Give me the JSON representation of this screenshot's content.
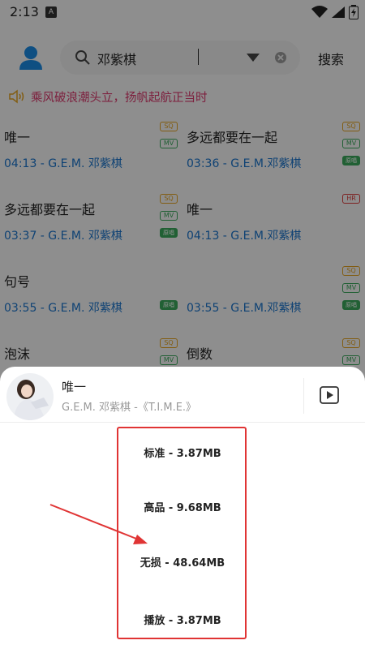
{
  "status": {
    "time": "2:13"
  },
  "search": {
    "query": "邓紫棋",
    "button": "搜索"
  },
  "notice": {
    "text": "乘风破浪潮头立，扬帆起航正当时"
  },
  "songs": [
    {
      "title": "唯一",
      "meta": "04:13 - G.E.M. 邓紫棋",
      "badges": [
        "SQ",
        "MV"
      ]
    },
    {
      "title": "多远都要在一起",
      "meta": "03:36 - G.E.M.邓紫棋",
      "badges": [
        "SQ",
        "MV",
        "原唱"
      ]
    },
    {
      "title": "多远都要在一起",
      "meta": "03:37 - G.E.M. 邓紫棋",
      "badges": [
        "SQ",
        "MV",
        "原唱"
      ]
    },
    {
      "title": "唯一",
      "meta": "04:13 - G.E.M.邓紫棋",
      "badges": [
        "HR"
      ]
    },
    {
      "title": "句号",
      "meta": "03:55 - G.E.M. 邓紫棋",
      "badges": [
        "原唱"
      ]
    },
    {
      "title": "",
      "meta": "03:55 - G.E.M.邓紫棋",
      "badges": [
        "SQ",
        "MV",
        "原唱"
      ]
    },
    {
      "title": "泡沫",
      "meta": "",
      "badges": [
        "SQ",
        "MV"
      ]
    },
    {
      "title": "倒数",
      "meta": "",
      "badges": [
        "SQ",
        "MV"
      ]
    }
  ],
  "sheet": {
    "title": "唯一",
    "subtitle": "G.E.M. 邓紫棋 -《T.I.M.E.》",
    "options": [
      "标准 - 3.87MB",
      "高品 - 9.68MB",
      "无损 - 48.64MB",
      "播放 - 3.87MB"
    ]
  }
}
